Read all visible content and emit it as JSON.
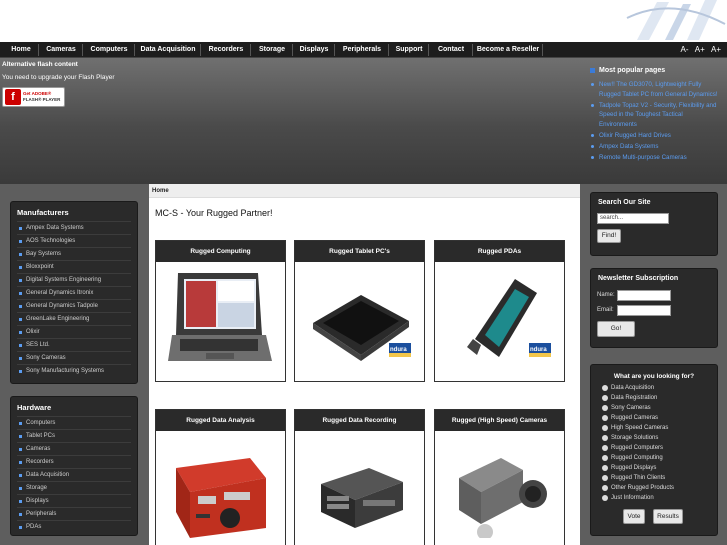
{
  "nav": [
    "Home",
    "Cameras",
    "Computers",
    "Data Acquisition",
    "Recorders",
    "Storage",
    "Displays",
    "Peripherals",
    "Support",
    "Contact",
    "Become a Reseller"
  ],
  "font_controls": [
    "A-",
    "A+",
    "A+"
  ],
  "flash": {
    "title": "Alternative flash content",
    "message": "You need to upgrade your Flash Player",
    "badge_line1": "Get ADOBE®",
    "badge_line2": "FLASH® PLAYER"
  },
  "popular": {
    "title": "Most popular pages",
    "items": [
      "New!! The GD3070, Lightweight Fully Rugged Tablet PC from General Dynamics!",
      "Tadpole Topaz V2 - Security, Flexibility and Speed in the Toughest Tactical Environments",
      "Olixir Rugged Hard Drives",
      "Ampex Data Systems",
      "Remote Multi-purpose Cameras"
    ]
  },
  "manufacturers": {
    "title": "Manufacturers",
    "items": [
      "Ampex Data Systems",
      "AOS Technologies",
      "Bay Systems",
      "Bloxxpoint",
      "Digital Systems Engineering",
      "General Dynamics Itronix",
      "General Dynamics Tadpole",
      "GreenLake Engineering",
      "Olixir",
      "SES Ltd.",
      "Sony Cameras",
      "Sony Manufacturing Systems"
    ]
  },
  "hardware": {
    "title": "Hardware",
    "items": [
      "Computers",
      "Tablet PCs",
      "Cameras",
      "Recorders",
      "Data Acquisition",
      "Storage",
      "Displays",
      "Peripherals",
      "PDAs"
    ]
  },
  "breadcrumb": "Home",
  "page_title": "MC-S - Your Rugged Partner!",
  "products": [
    "Rugged Computing",
    "Rugged Tablet PC's",
    "Rugged PDAs",
    "Rugged Data Analysis",
    "Rugged Data Recording",
    "Rugged (High Speed) Cameras"
  ],
  "search": {
    "title": "Search Our Site",
    "placeholder": "search...",
    "button": "Find!"
  },
  "newsletter": {
    "title": "Newsletter Subscription",
    "name_label": "Name:",
    "email_label": "Email:",
    "button": "Go!"
  },
  "poll": {
    "title": "What are you looking for?",
    "options": [
      "Data Acquisition",
      "Data Registration",
      "Sony Cameras",
      "Rugged Cameras",
      "High Speed Cameras",
      "Storage Solutions",
      "Rugged Computers",
      "Rugged Computing",
      "Rugged Displays",
      "Rugged Thin Clients",
      "Other Rugged Products",
      "Just Information"
    ],
    "vote": "Vote",
    "results": "Results"
  },
  "badges": {
    "indura1": "ndura",
    "indura2": "ndura"
  }
}
